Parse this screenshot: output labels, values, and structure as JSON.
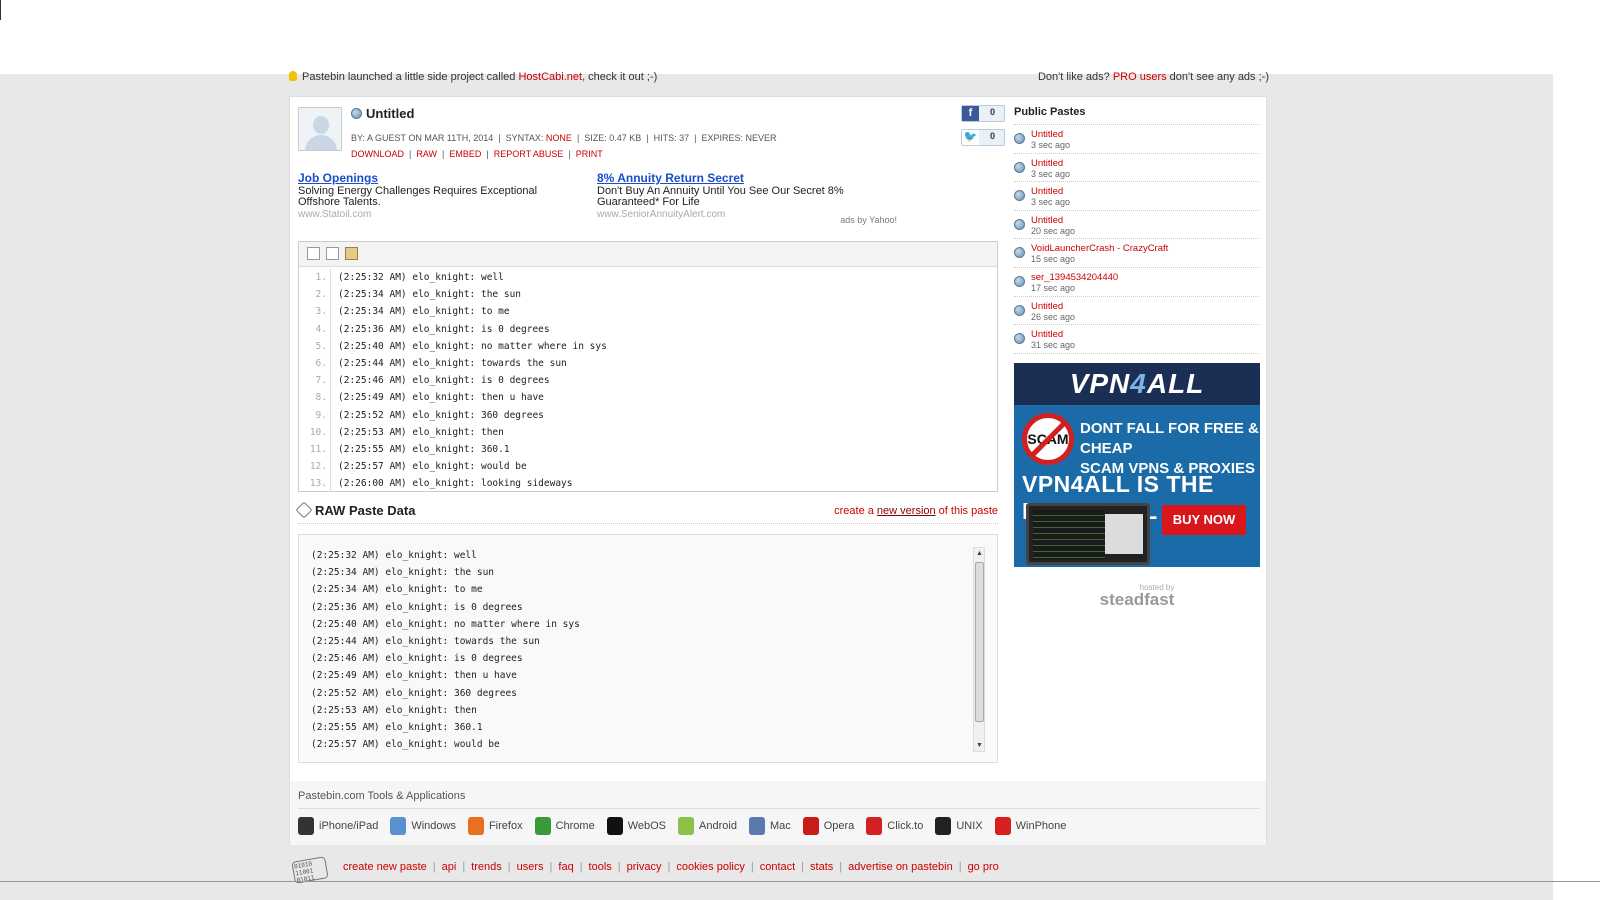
{
  "notice": {
    "left_prefix": "Pastebin launched a little side project called ",
    "left_link": "HostCabi.net",
    "left_suffix": ", check it out ;-)",
    "right_prefix": "Don't like ads? ",
    "right_link": "PRO users",
    "right_suffix": " don't see any ads ;-)"
  },
  "paste": {
    "title": "Untitled",
    "by": "BY: A GUEST ON MAR 11TH, 2014",
    "syntax_label": "SYNTAX: ",
    "syntax_value": "NONE",
    "size": "SIZE: 0.47 KB",
    "hits": "HITS: 37",
    "expires": "EXPIRES: NEVER",
    "actions": [
      "DOWNLOAD",
      "RAW",
      "EMBED",
      "REPORT ABUSE",
      "PRINT"
    ]
  },
  "social": {
    "facebook_count": "0",
    "twitter_count": "0",
    "facebook_glyph": "f",
    "twitter_glyph": "🐦"
  },
  "ads": [
    {
      "title": "Job Openings",
      "desc": "Solving Energy Challenges Requires Exceptional Offshore Talents.",
      "url": "www.Statoil.com"
    },
    {
      "title": "8% Annuity Return Secret",
      "desc": "Don't Buy An Annuity Until You See Our Secret 8% Guaranteed* For Life",
      "url": "www.SeniorAnnuityAlert.com"
    }
  ],
  "ads_by": "ads by Yahoo!",
  "code_lines": [
    "(2:25:32 AM) elo_knight: well",
    "(2:25:34 AM) elo_knight: the sun",
    "(2:25:34 AM) elo_knight: to me",
    "(2:25:36 AM) elo_knight: is 0 degrees",
    "(2:25:40 AM) elo_knight: no matter where in sys",
    "(2:25:44 AM) elo_knight: towards the sun",
    "(2:25:46 AM) elo_knight: is 0 degrees",
    "(2:25:49 AM) elo_knight: then u have",
    "(2:25:52 AM) elo_knight: 360 degrees",
    "(2:25:53 AM) elo_knight: then",
    "(2:25:55 AM) elo_knight: 360.1",
    "(2:25:57 AM) elo_knight: would be",
    "(2:26:00 AM) elo_knight: looking sideways"
  ],
  "code_line_numbers": [
    "1.",
    "2.",
    "3.",
    "4.",
    "5.",
    "6.",
    "7.",
    "8.",
    "9.",
    "10.",
    "11.",
    "12.",
    "13."
  ],
  "raw": {
    "title": "RAW Paste Data",
    "create_prefix": "create a ",
    "create_link": "new version",
    "create_suffix": " of this paste",
    "lines": [
      "(2:25:32 AM) elo_knight: well",
      "(2:25:34 AM) elo_knight: the sun",
      "(2:25:34 AM) elo_knight: to me",
      "(2:25:36 AM) elo_knight: is 0 degrees",
      "(2:25:40 AM) elo_knight: no matter where in sys",
      "(2:25:44 AM) elo_knight: towards the sun",
      "(2:25:46 AM) elo_knight: is 0 degrees",
      "(2:25:49 AM) elo_knight: then u have",
      "(2:25:52 AM) elo_knight: 360 degrees",
      "(2:25:53 AM) elo_knight: then",
      "(2:25:55 AM) elo_knight: 360.1",
      "(2:25:57 AM) elo_knight: would be"
    ]
  },
  "public_pastes": {
    "title": "Public Pastes",
    "items": [
      {
        "name": "Untitled",
        "ago": "3 sec ago"
      },
      {
        "name": "Untitled",
        "ago": "3 sec ago"
      },
      {
        "name": "Untitled",
        "ago": "3 sec ago"
      },
      {
        "name": "Untitled",
        "ago": "20 sec ago"
      },
      {
        "name": "VoidLauncherCrash - CrazyCraft",
        "ago": "15 sec ago"
      },
      {
        "name": "ser_1394534204440",
        "ago": "17 sec ago"
      },
      {
        "name": "Untitled",
        "ago": "26 sec ago"
      },
      {
        "name": "Untitled",
        "ago": "31 sec ago"
      }
    ]
  },
  "vpn_ad": {
    "brand_a": "VPN",
    "brand_b": "4",
    "brand_c": "ALL",
    "scam": "SCAM",
    "line1": "DONT FALL FOR FREE & CHEAP",
    "line2": "SCAM VPNS & PROXIES",
    "big": "VPN4ALL IS THE REAL DEAL",
    "buy": "BUY NOW"
  },
  "hosted": {
    "small": "hosted by",
    "big": "steadfast"
  },
  "tools": {
    "title": "Pastebin.com Tools & Applications",
    "items": [
      {
        "label": "iPhone/iPad",
        "color": "#333333"
      },
      {
        "label": "Windows",
        "color": "#5a8fd0"
      },
      {
        "label": "Firefox",
        "color": "#e8701e"
      },
      {
        "label": "Chrome",
        "color": "#3a9a3a"
      },
      {
        "label": "WebOS",
        "color": "#111111"
      },
      {
        "label": "Android",
        "color": "#8cc04a"
      },
      {
        "label": "Mac",
        "color": "#5a7ab0"
      },
      {
        "label": "Opera",
        "color": "#cc1b1b"
      },
      {
        "label": "Click.to",
        "color": "#d42020"
      },
      {
        "label": "UNIX",
        "color": "#222222"
      },
      {
        "label": "WinPhone",
        "color": "#d8201e"
      }
    ]
  },
  "footer": {
    "logo": "01010 11001 01011",
    "links": [
      "create new paste",
      "api",
      "trends",
      "users",
      "faq",
      "tools",
      "privacy",
      "cookies policy",
      "contact",
      "stats",
      "advertise on pastebin",
      "go pro"
    ]
  }
}
